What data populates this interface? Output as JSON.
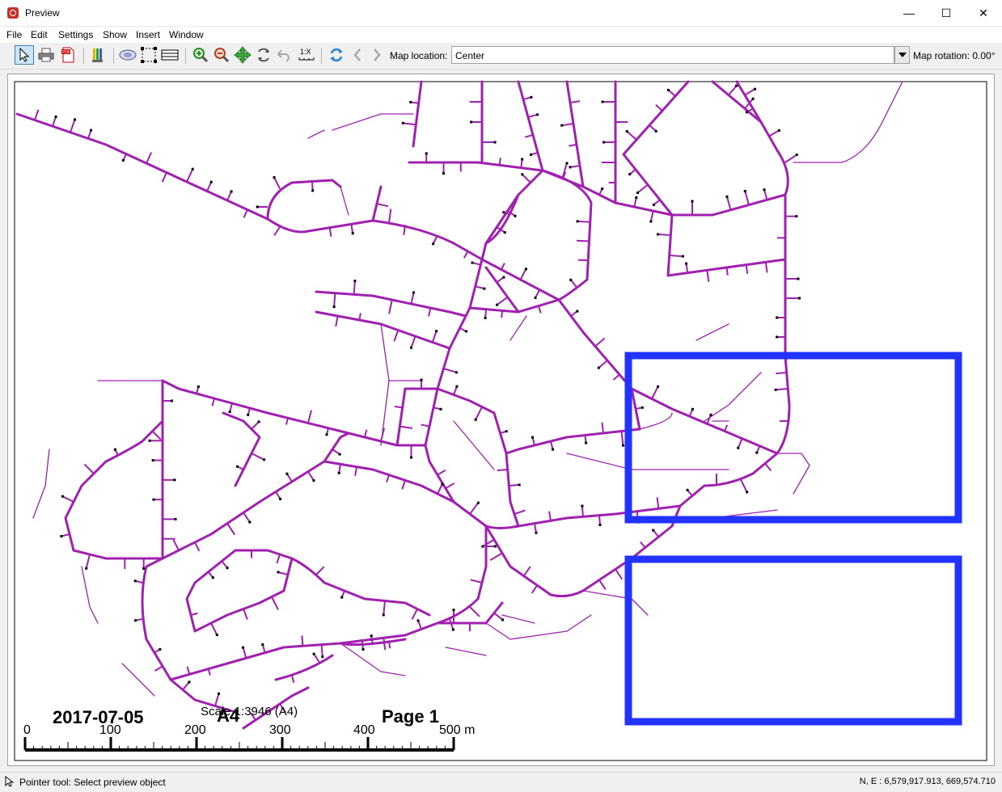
{
  "window": {
    "title": "Preview"
  },
  "menu": [
    "File",
    "Edit",
    "Settings",
    "Show",
    "Insert",
    "Window"
  ],
  "toolbar": {
    "map_location_label": "Map location:",
    "map_location_value": "Center",
    "map_rotation_label": "Map rotation: 0.00°",
    "scale_tool_label": "1:X"
  },
  "map": {
    "date": "2017-07-05",
    "scale_text": "Scale 1:3946 (A4)",
    "paper": "A4",
    "page_label": "Page 1",
    "scalebar_ticks": [
      "0",
      "100",
      "200",
      "300",
      "400",
      "500 m"
    ],
    "network_color": "#a020b0",
    "frame_color": "#2233ff"
  },
  "status": {
    "tool_text": "Pointer tool: Select preview object",
    "coordinates": "N, E : 6,579,917.913, 669,574.710"
  }
}
